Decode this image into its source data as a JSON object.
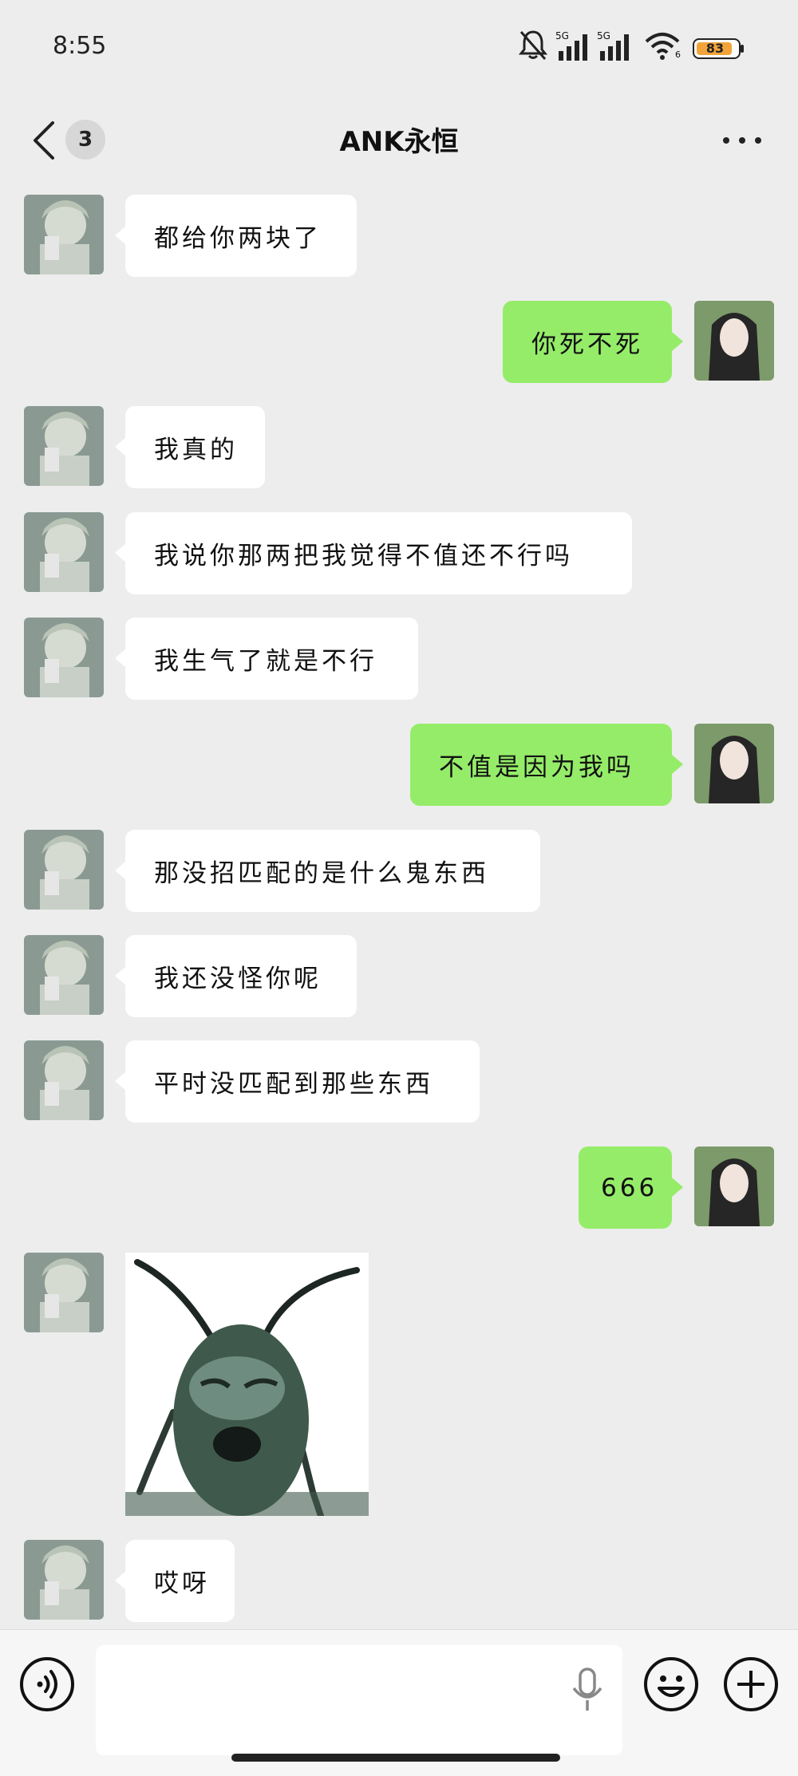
{
  "status_bar": {
    "time": "8:55",
    "net1": "5G",
    "net2": "5G",
    "wifi_sub": "6",
    "battery": "83"
  },
  "header": {
    "unread_count": "3",
    "title": "ANK永恒"
  },
  "messages": [
    {
      "side": "in",
      "text": "都给你两块了"
    },
    {
      "side": "out",
      "text": "你死不死"
    },
    {
      "side": "in",
      "text": "我真的"
    },
    {
      "side": "in",
      "text": "我说你那两把我觉得不值还不行吗"
    },
    {
      "side": "in",
      "text": "我生气了就是不行"
    },
    {
      "side": "out",
      "text": "不值是因为我吗"
    },
    {
      "side": "in",
      "text": "那没招匹配的是什么鬼东西"
    },
    {
      "side": "in",
      "text": "我还没怪你呢"
    },
    {
      "side": "in",
      "text": "平时没匹配到那些东西"
    },
    {
      "side": "out",
      "text": "666"
    },
    {
      "side": "in",
      "type": "sticker"
    },
    {
      "side": "in",
      "text": "哎呀"
    }
  ],
  "colors": {
    "outgoing_bubble": "#95ec69",
    "incoming_bubble": "#ffffff",
    "background": "#ededed"
  }
}
